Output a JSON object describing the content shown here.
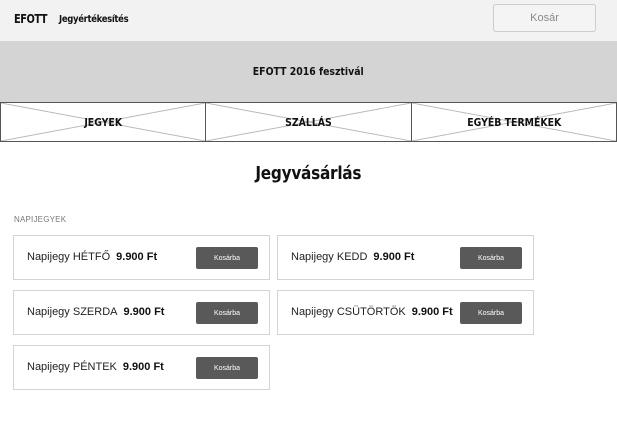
{
  "header": {
    "brand": "EFOTT",
    "subtitle": "Jegyértékesítés",
    "cart_label": "Kosár"
  },
  "hero": {
    "title": "EFOTT 2016 fesztivál"
  },
  "tabs": [
    {
      "label": "JEGYEK"
    },
    {
      "label": "SZÁLLÁS"
    },
    {
      "label": "EGYÉB TERMÉKEK"
    }
  ],
  "page": {
    "title": "Jegyvásárlás",
    "section_label": "NAPIJEGYEK"
  },
  "tickets": [
    {
      "name": "Napijegy HÉTFŐ",
      "price": "9.900 Ft",
      "button": "Kosárba"
    },
    {
      "name": "Napijegy KEDD",
      "price": "9.900 Ft",
      "button": "Kosárba"
    },
    {
      "name": "Napijegy SZERDA",
      "price": "9.900 Ft",
      "button": "Kosárba"
    },
    {
      "name": "Napijegy CSÜTÖRTÖK",
      "price": "9.900 Ft",
      "button": "Kosárba"
    },
    {
      "name": "Napijegy PÉNTEK",
      "price": "9.900 Ft",
      "button": "Kosárba"
    }
  ]
}
